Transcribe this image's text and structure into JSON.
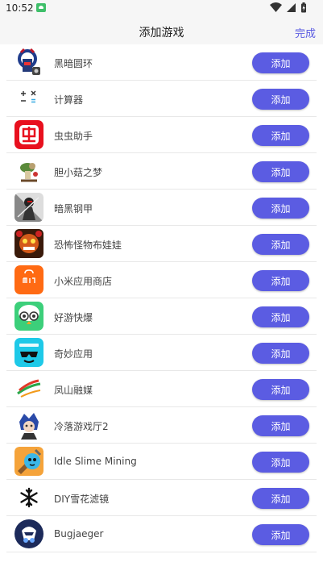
{
  "status_bar": {
    "time": "10:52",
    "notification_icon": "cloud-icon"
  },
  "header": {
    "title": "添加游戏",
    "done_label": "完成"
  },
  "accent_color": "#5b5ce2",
  "games": [
    {
      "name": "黑暗圆环",
      "button": "添加",
      "icon": "dark-ring-icon"
    },
    {
      "name": "计算器",
      "button": "添加",
      "icon": "calculator-icon"
    },
    {
      "name": "虫虫助手",
      "button": "添加",
      "icon": "chongchong-icon"
    },
    {
      "name": "胆小菇之梦",
      "button": "添加",
      "icon": "mushroom-dream-icon"
    },
    {
      "name": "暗黑钢甲",
      "button": "添加",
      "icon": "dark-armor-icon"
    },
    {
      "name": "恐怖怪物布娃娃",
      "button": "添加",
      "icon": "horror-doll-icon"
    },
    {
      "name": "小米应用商店",
      "button": "添加",
      "icon": "mi-store-icon"
    },
    {
      "name": "好游快爆",
      "button": "添加",
      "icon": "haoyou-icon"
    },
    {
      "name": "奇妙应用",
      "button": "添加",
      "icon": "magic-app-icon"
    },
    {
      "name": "凤山融媒",
      "button": "添加",
      "icon": "fengshan-icon"
    },
    {
      "name": "冷落游戏厅2",
      "button": "添加",
      "icon": "arcade-icon"
    },
    {
      "name": "Idle Slime Mining",
      "button": "添加",
      "icon": "slime-mining-icon"
    },
    {
      "name": "DIY雪花滤镜",
      "button": "添加",
      "icon": "snowflake-icon"
    },
    {
      "name": "Bugjaeger",
      "button": "添加",
      "icon": "bugjaeger-icon"
    }
  ]
}
